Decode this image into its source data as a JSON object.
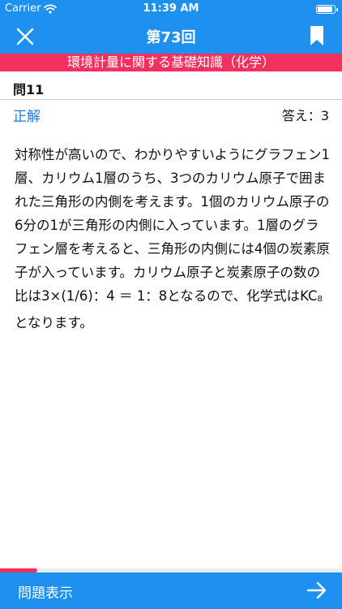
{
  "status": {
    "carrier": "Carrier",
    "time": "11:39 AM"
  },
  "nav": {
    "title": "第73回"
  },
  "banner": {
    "category": "環境計量に関する基礎知識（化学）"
  },
  "question": {
    "number": "問11",
    "result": "正解",
    "answer": "答え：3"
  },
  "explanation": {
    "text": "対称性が高いので、わかりやすいようにグラフェン1層、カリウム1層のうち、3つのカリウム原子で囲まれた三角形の内側を考えます。1個のカリウム原子の6分の1が三角形の内側に入っています。1層のグラフェン層を考えると、三角形の内側には4個の炭素原子が入っています。カリウム原子と炭素原子の数の比は3×(1/6)：4 ＝ 1：8となるので、化学式はKC",
    "subscript": "8",
    "tail": "となります。"
  },
  "progress": {
    "fraction": 0.11
  },
  "bottom": {
    "show_question_label": "問題表示"
  },
  "icons": {
    "close": "close-icon",
    "bookmark": "bookmark-icon",
    "next": "arrow-right-icon",
    "wifi": "wifi-icon",
    "battery": "battery-icon"
  },
  "colors": {
    "primary": "#1e90f0",
    "accent": "#f2315f",
    "correct": "#1e7ce6"
  }
}
